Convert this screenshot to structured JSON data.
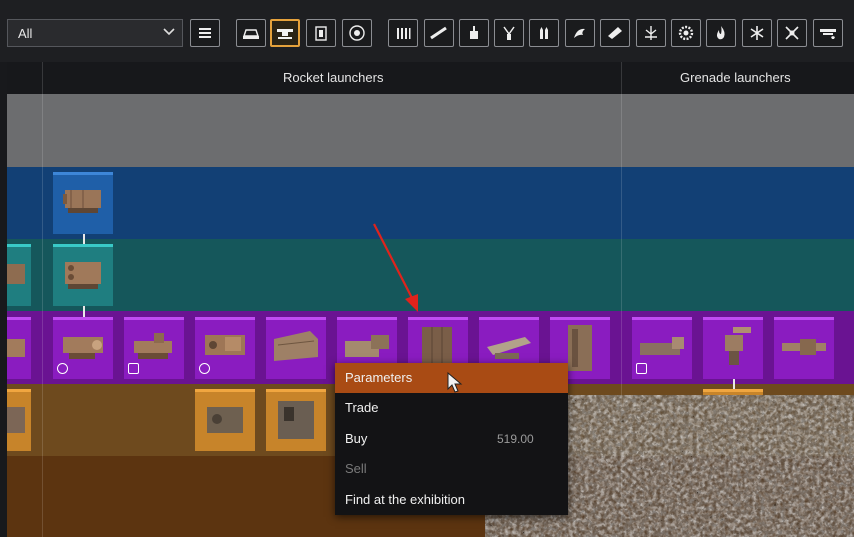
{
  "toolbar": {
    "filter": {
      "selected": "All"
    },
    "buttons": [
      {
        "icon": "list-icon",
        "active": false
      },
      {
        "icon": "cabin-icon",
        "active": false
      },
      {
        "icon": "weapons-icon",
        "active": true
      },
      {
        "icon": "modules-icon",
        "active": false
      },
      {
        "icon": "wheel-icon",
        "active": false
      },
      {
        "icon": "ammo-icon",
        "active": false
      },
      {
        "icon": "shotgun-icon",
        "active": false
      },
      {
        "icon": "turret-icon",
        "active": false
      },
      {
        "icon": "flamethrower-nozzle-icon",
        "active": false
      },
      {
        "icon": "missiles-icon",
        "active": false
      },
      {
        "icon": "dragon-icon",
        "active": false
      },
      {
        "icon": "melee-icon",
        "active": false
      },
      {
        "icon": "tesla-icon",
        "active": false
      },
      {
        "icon": "gear-icon",
        "active": false
      },
      {
        "icon": "fire-icon",
        "active": false
      },
      {
        "icon": "snowflake-icon",
        "active": false
      },
      {
        "icon": "drone-icon",
        "active": false
      },
      {
        "icon": "special-weapon-icon",
        "active": false
      }
    ]
  },
  "columns": [
    {
      "label": "Rocket launchers"
    },
    {
      "label": "Grenade launchers"
    }
  ],
  "context_menu": {
    "items": [
      {
        "label": "Parameters",
        "state": "highlighted"
      },
      {
        "label": "Trade",
        "state": "normal"
      },
      {
        "label": "Buy",
        "state": "normal"
      },
      {
        "label": "Sell",
        "state": "disabled"
      },
      {
        "label": "Find at the exhibition",
        "state": "normal"
      }
    ],
    "price": "519.00"
  },
  "rarity_colors": {
    "common": "#6c6d6f",
    "rare": "#124075",
    "special": "#15575b",
    "epic": "#6a1392",
    "legendary": "#6e4a1e",
    "accent": "#e6a23c"
  }
}
